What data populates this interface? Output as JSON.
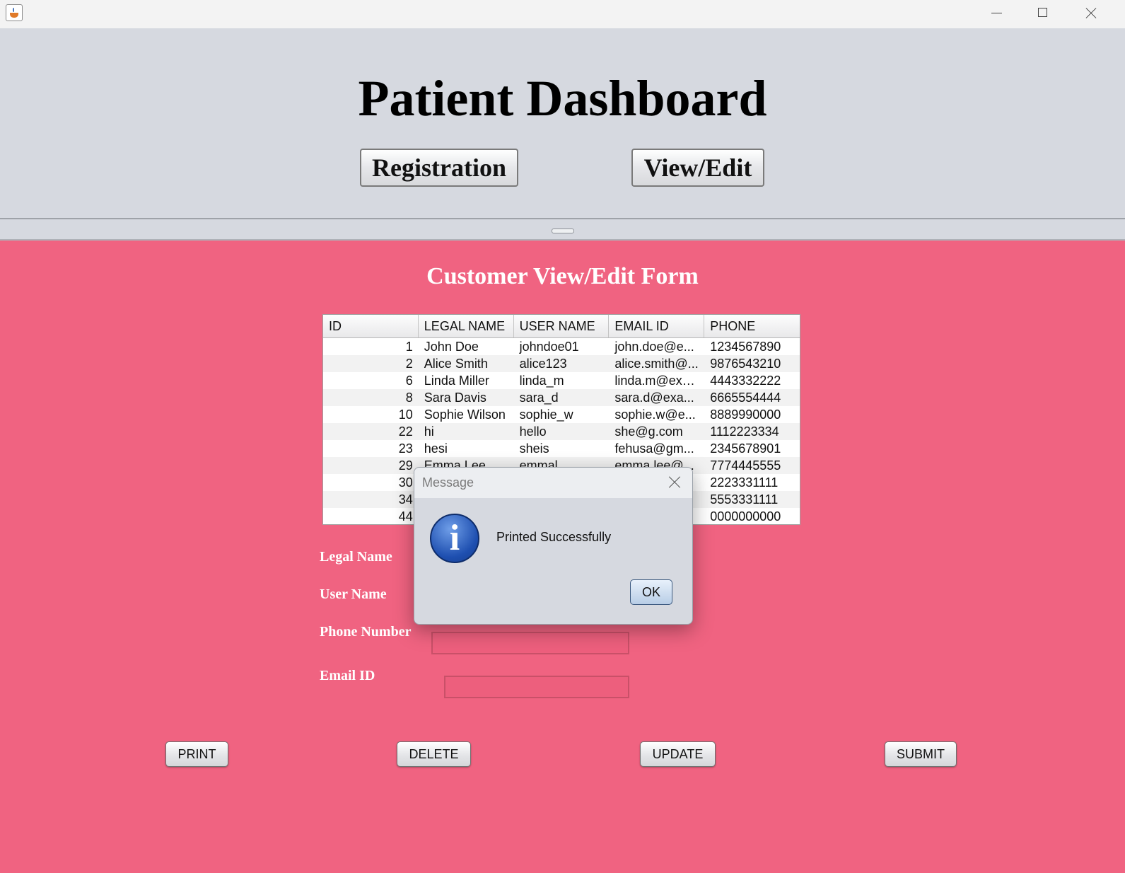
{
  "window": {
    "min_icon": "minimize-icon",
    "max_icon": "maximize-icon",
    "close_icon": "close-icon",
    "app_icon": "java-cup-icon"
  },
  "header": {
    "title": "Patient Dashboard",
    "registration_label": "Registration",
    "view_edit_label": "View/Edit"
  },
  "form": {
    "title": "Customer View/Edit Form",
    "table": {
      "columns": [
        "ID",
        "LEGAL NAME",
        "USER NAME",
        "EMAIL ID",
        "PHONE"
      ],
      "rows": [
        [
          "1",
          "John Doe",
          "johndoe01",
          "john.doe@e...",
          "1234567890"
        ],
        [
          "2",
          "Alice Smith",
          "alice123",
          "alice.smith@...",
          "9876543210"
        ],
        [
          "6",
          "Linda Miller",
          "linda_m",
          "linda.m@exa...",
          "4443332222"
        ],
        [
          "8",
          "Sara Davis",
          "sara_d",
          "sara.d@exa...",
          "6665554444"
        ],
        [
          "10",
          "Sophie Wilson",
          "sophie_w",
          "sophie.w@e...",
          "8889990000"
        ],
        [
          "22",
          "hi",
          "hello",
          "she@g.com",
          "1112223334"
        ],
        [
          "23",
          "hesi",
          "sheis",
          "fehusa@gm...",
          "2345678901"
        ],
        [
          "29",
          "Emma Lee",
          "emmal",
          "emma.lee@...",
          "7774445555"
        ],
        [
          "30",
          "",
          "",
          "",
          "2223331111"
        ],
        [
          "34",
          "",
          "",
          "",
          "5553331111"
        ],
        [
          "44",
          "",
          "",
          "",
          "0000000000"
        ]
      ]
    },
    "labels": {
      "legal_name": "Legal Name",
      "user_name": "User Name",
      "phone": "Phone Number",
      "email": "Email ID"
    },
    "buttons": {
      "print": "PRINT",
      "delete": "DELETE",
      "update": "UPDATE",
      "submit": "SUBMIT"
    }
  },
  "dialog": {
    "title": "Message",
    "message": "Printed Successfully",
    "ok": "OK",
    "icon": "info-icon",
    "icon_glyph": "i"
  },
  "colors": {
    "top_panel": "#d6d9e0",
    "form_background": "#f06381"
  }
}
